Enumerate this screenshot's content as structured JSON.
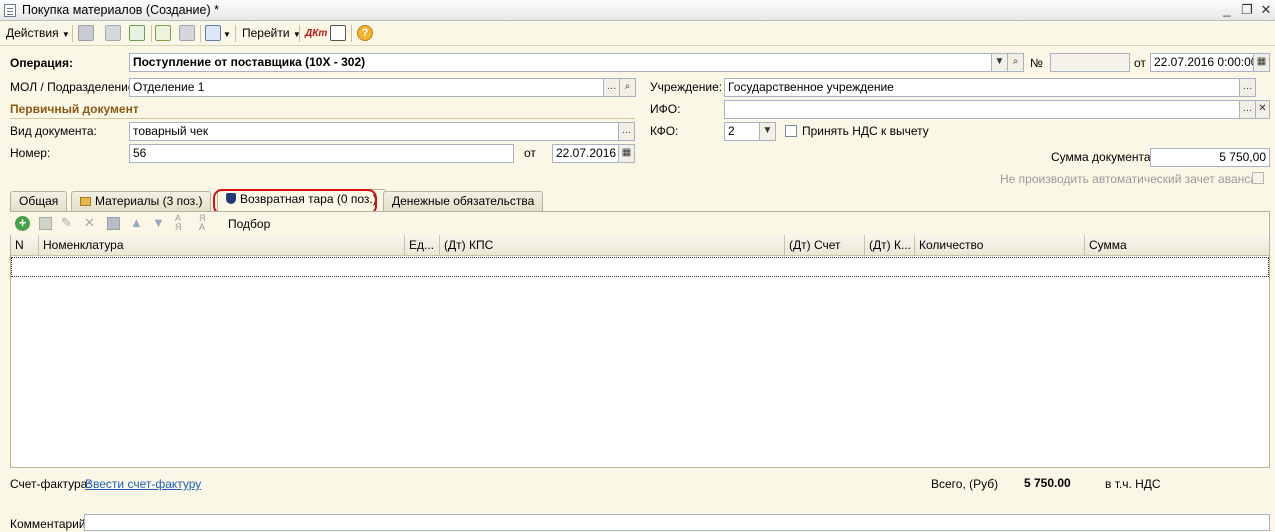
{
  "window": {
    "title": "Покупка материалов (Создание) *"
  },
  "toolbar": {
    "actions_label": "Действия",
    "goto_label": "Перейти"
  },
  "header": {
    "operation_label": "Операция:",
    "operation_value": "Поступление от поставщика (10Х - 302)",
    "number_label": "№",
    "number_value": "",
    "date_from_label": "от",
    "date_value": "22.07.2016  0:00:00",
    "mol_label": "МОЛ / Подразделение:",
    "mol_value": "Отделение 1",
    "institution_label": "Учреждение:",
    "institution_value": "Государственное учреждение",
    "ifo_label": "ИФО:",
    "ifo_value": "",
    "kfo_label": "КФО:",
    "kfo_value": "2",
    "vat_checkbox_label": "Принять НДС к вычету",
    "sum_label": "Сумма документа:",
    "sum_value": "5 750,00",
    "no_offset_label": "Не производить автоматический зачет аванса"
  },
  "primary_doc": {
    "section_title": "Первичный документ",
    "doc_type_label": "Вид документа:",
    "doc_type_value": "товарный чек",
    "number_label": "Номер:",
    "number_value": "56",
    "date_label": "от",
    "date_value": "22.07.2016"
  },
  "tabs": [
    {
      "label": "Общая"
    },
    {
      "label": "Материалы (3 поз.)"
    },
    {
      "label": "Возвратная тара (0 поз.)"
    },
    {
      "label": "Денежные обязательства"
    }
  ],
  "grid": {
    "selection_label": "Подбор",
    "columns": [
      "N",
      "Номенклатура",
      "Ед...",
      "(Дт) КПС",
      "(Дт) Счет",
      "(Дт) К...",
      "Количество",
      "Сумма"
    ]
  },
  "footer": {
    "invoice_label": "Счет-фактура:",
    "invoice_link": "Ввести счет-фактуру",
    "total_label": "Всего, (Руб)",
    "total_value": "5 750.00",
    "vat_label": "в т.ч. НДС",
    "comment_label": "Комментарий:",
    "comment_value": ""
  },
  "colors": {
    "background": "#fbf7e7",
    "section": "#8b5a14",
    "highlight_ring": "#d01010",
    "link": "#1f5fb8"
  }
}
